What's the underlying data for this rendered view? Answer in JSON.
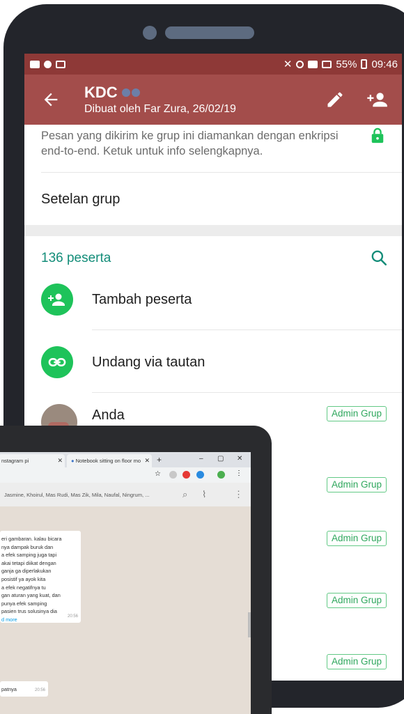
{
  "phone": {
    "status_bar": {
      "battery": "55%",
      "time": "09:46"
    },
    "app_bar": {
      "title": "KDC",
      "subtitle": "Dibuat oleh Far Zura, 26/02/19"
    },
    "encryption_notice": "Pesan yang dikirim ke grup ini diamankan dengan enkripsi end-to-end. Ketuk untuk info selengkapnya.",
    "group_settings_label": "Setelan grup",
    "participants": {
      "count_label": "136 peserta",
      "add_label": "Tambah peserta",
      "invite_label": "Undang via tautan",
      "members": [
        {
          "name": "Anda",
          "badge": "Admin Grup"
        }
      ],
      "extra_admin_badges": [
        "Admin Grup",
        "Admin Grup",
        "Admin Grup",
        "Admin Grup"
      ]
    },
    "colors": {
      "status_bar": "#8e3937",
      "app_bar": "#a34d4b",
      "accent": "#138d79",
      "action_green": "#1ec35a"
    }
  },
  "laptop": {
    "tabs": [
      {
        "label": "nstagram pi"
      },
      {
        "label": "Notebook sitting on floor mo"
      }
    ],
    "new_tab": "+",
    "window_controls": {
      "minimize": "–",
      "maximize": "▢",
      "close": "✕"
    },
    "chat_header_members": "Jasmine, Khoirul, Mas Rudi, Mas Zik, Mila, Naufal, Ningrum, ...",
    "message_1": {
      "lines": [
        "eri gambaran. kalau bicara",
        "nya dampak buruk dan",
        "a efek samping juga tapi",
        "akai tetapi diikat dengan",
        "ganja ga diperlakukan",
        "posistif ya ayok kita",
        "a efek negatifnya tu",
        "gan aturan yang kuat, dan",
        "punya efek samping",
        "pasien trus solusinya dia"
      ],
      "read_more": "d more",
      "time": "20:56"
    },
    "message_2": {
      "text": "patnya",
      "time": "20:56"
    }
  }
}
